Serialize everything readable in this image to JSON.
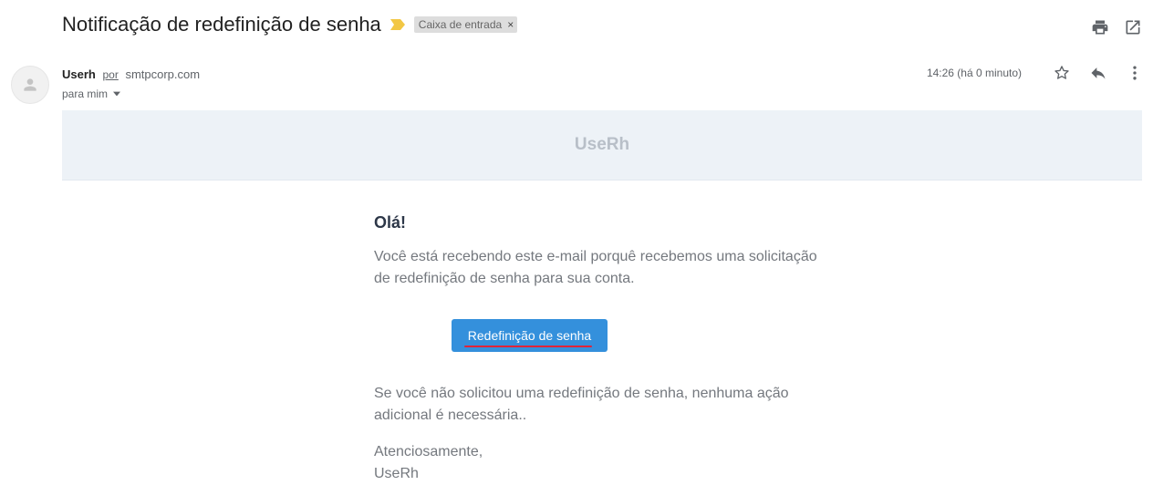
{
  "email": {
    "subject": "Notificação de redefinição de senha",
    "label": "Caixa de entrada",
    "label_close": "×",
    "sender_name": "Userh",
    "via": "por",
    "sender_domain": "smtpcorp.com",
    "recipient": "para mim",
    "timestamp": "14:26 (há 0 minuto)"
  },
  "icons": {
    "importance": "importance-marker-icon",
    "print": "print-icon",
    "popout": "open-in-new-window-icon",
    "star": "star-icon",
    "reply": "reply-icon",
    "more": "more-vertical-icon",
    "avatar": "person-icon",
    "caret": "caret-down-icon"
  },
  "colors": {
    "importance": "#f2c744",
    "button": "#3490dc",
    "banner_bg": "#edf2f7",
    "annotation_underline": "#e0243a"
  },
  "body": {
    "brand": "UseRh",
    "greeting": "Olá!",
    "intro": "Você está recebendo este e-mail porquê recebemos uma solicitação de redefinição de senha para sua conta.",
    "button_label": "Redefinição de senha",
    "outro": "Se você não solicitou uma redefinição de senha, nenhuma ação adicional é necessária..",
    "regards": "Atenciosamente,",
    "signature": "UseRh"
  }
}
